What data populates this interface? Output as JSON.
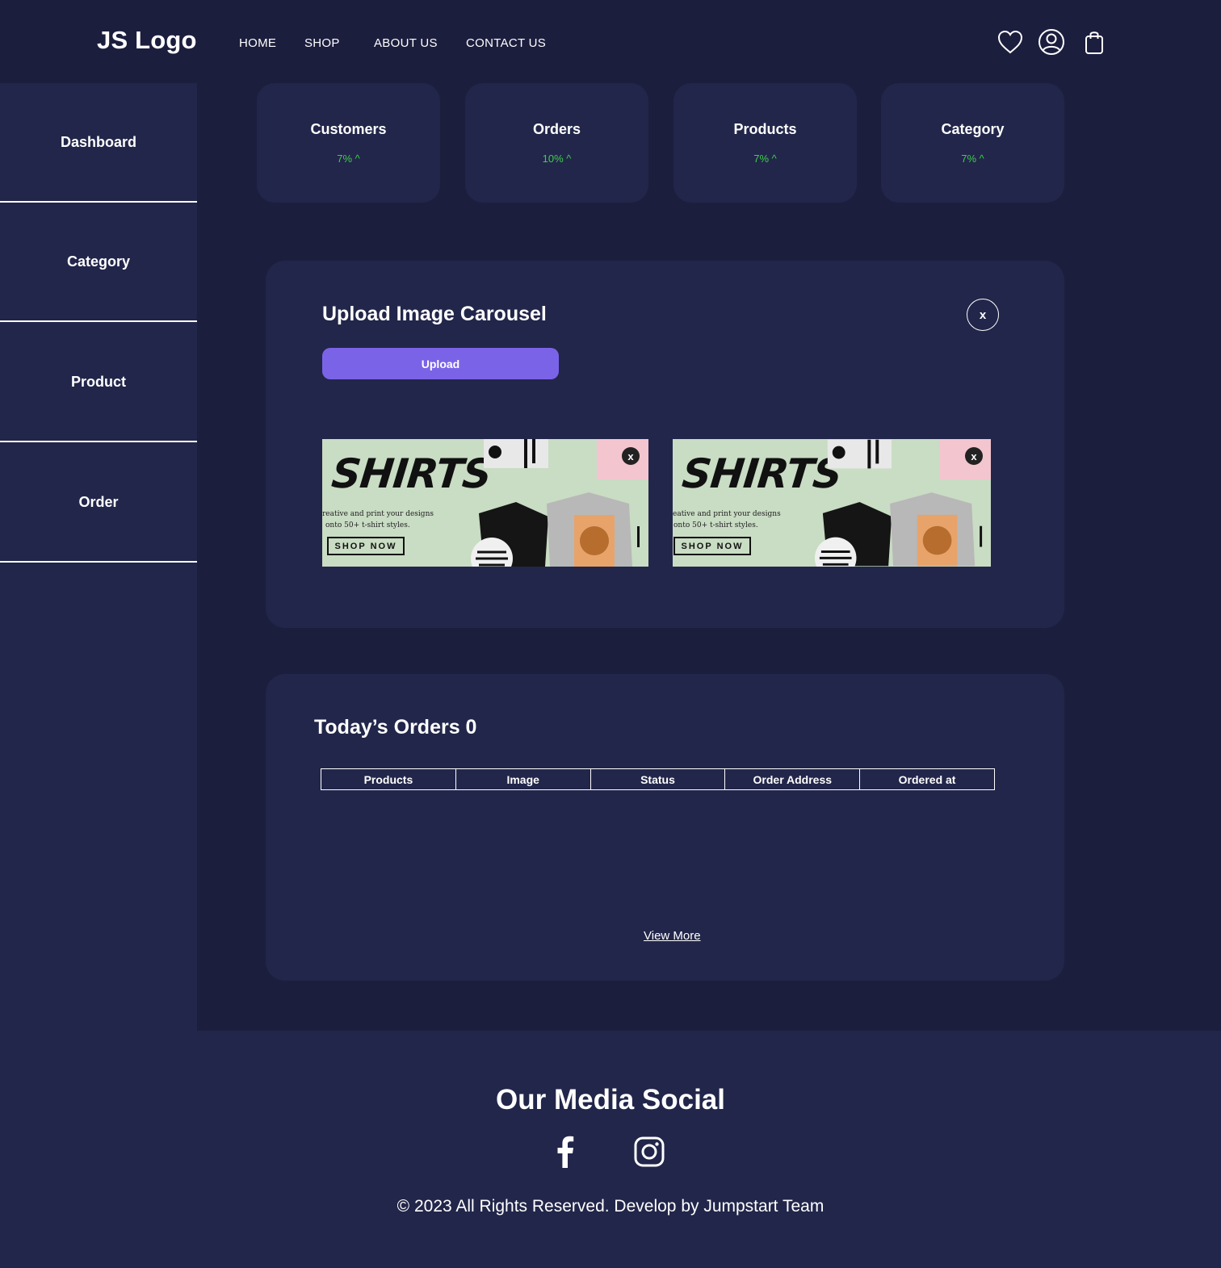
{
  "header": {
    "logo": "JS Logo",
    "nav": [
      "HOME",
      "SHOP",
      "ABOUT US",
      "CONTACT US"
    ],
    "icons": [
      "heart-icon",
      "user-icon",
      "shopping-bag-icon"
    ]
  },
  "sidebar": {
    "items": [
      {
        "label": "Dashboard"
      },
      {
        "label": "Category"
      },
      {
        "label": "Product"
      },
      {
        "label": "Order"
      }
    ]
  },
  "stats": [
    {
      "title": "Customers",
      "change": "7% ^"
    },
    {
      "title": "Orders",
      "change": "10% ^"
    },
    {
      "title": "Products",
      "change": "7% ^"
    },
    {
      "title": "Category",
      "change": "7% ^"
    }
  ],
  "carousel": {
    "title": "Upload Image Carousel",
    "close_label": "x",
    "upload_label": "Upload",
    "images": [
      {
        "headline": "SHIRTS",
        "line1": "reative and print your designs",
        "line2": "onto 50+ t-shirt styles.",
        "cta": "SHOP NOW",
        "close": "x"
      },
      {
        "headline": "SHIRTS",
        "line1": "eative and print your designs",
        "line2": "onto 50+ t-shirt styles.",
        "cta": "SHOP NOW",
        "close": "x"
      }
    ]
  },
  "orders": {
    "title": "Today’s Orders 0",
    "columns": [
      "Products",
      "Image",
      "Status",
      "Order Address",
      "Ordered at"
    ],
    "view_more": "View More"
  },
  "footer": {
    "title": "Our Media Social",
    "socials": [
      "facebook-icon",
      "instagram-icon"
    ],
    "copyright": "© 2023 All Rights Reserved. Develop by Jumpstart Team"
  },
  "colors": {
    "background": "#1c1e3e",
    "panel": "#22264a",
    "accent": "#7b63e8",
    "positive": "#3ecf4a"
  }
}
